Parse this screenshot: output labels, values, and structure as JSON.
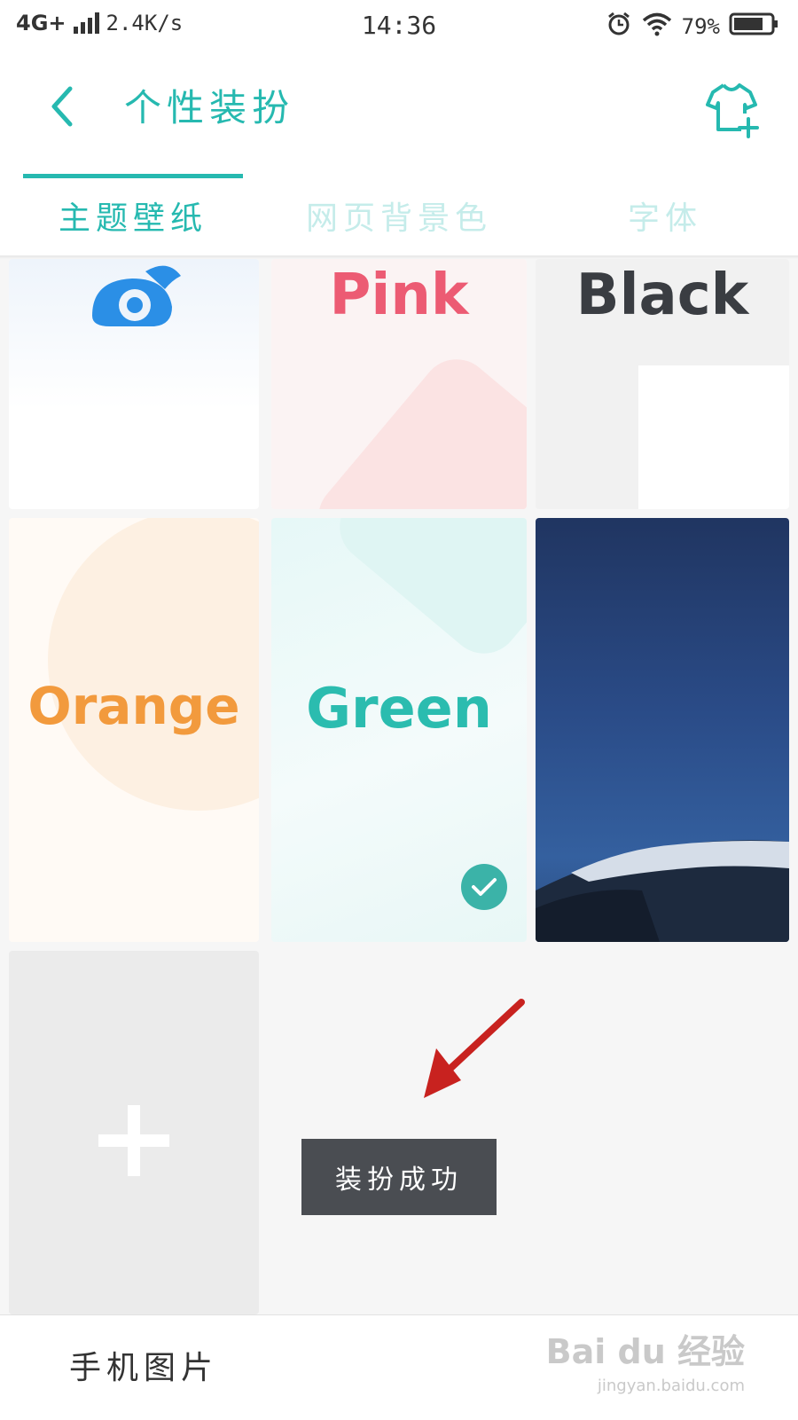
{
  "status_bar": {
    "network": "4G+",
    "speed": "2.4K/s",
    "time": "14:36",
    "battery": "79%",
    "icons": [
      "signal-icon",
      "alarm-icon",
      "wifi-icon",
      "battery-icon"
    ]
  },
  "header": {
    "title": "个性装扮",
    "back_icon": "chevron-left-icon",
    "action_icon": "shirt-add-icon"
  },
  "tabs": [
    {
      "label": "主题壁纸",
      "active": true
    },
    {
      "label": "网页背景色",
      "active": false
    },
    {
      "label": "字体",
      "active": false
    }
  ],
  "themes": [
    {
      "label": "",
      "icon": "uc-squirrel-logo",
      "selected": false
    },
    {
      "label": "Pink",
      "selected": false
    },
    {
      "label": "Black",
      "selected": false
    },
    {
      "label": "Orange",
      "selected": false
    },
    {
      "label": "Green",
      "selected": true
    },
    {
      "label": "",
      "image": "snowy-mountain-wallpaper",
      "selected": false
    }
  ],
  "add_tile_icon": "plus-icon",
  "toast": "装扮成功",
  "bottom": {
    "label": "手机图片"
  },
  "watermark": {
    "brand": "Bai du 经验",
    "url": "jingyan.baidu.com"
  },
  "colors": {
    "accent": "#26b9b0",
    "tab_inactive": "#c5ecea",
    "pink": "#ec5b73",
    "orange": "#f29a3d",
    "green": "#2bbcaf",
    "toast_bg": "#4a4d52",
    "arrow": "#c8221f"
  }
}
